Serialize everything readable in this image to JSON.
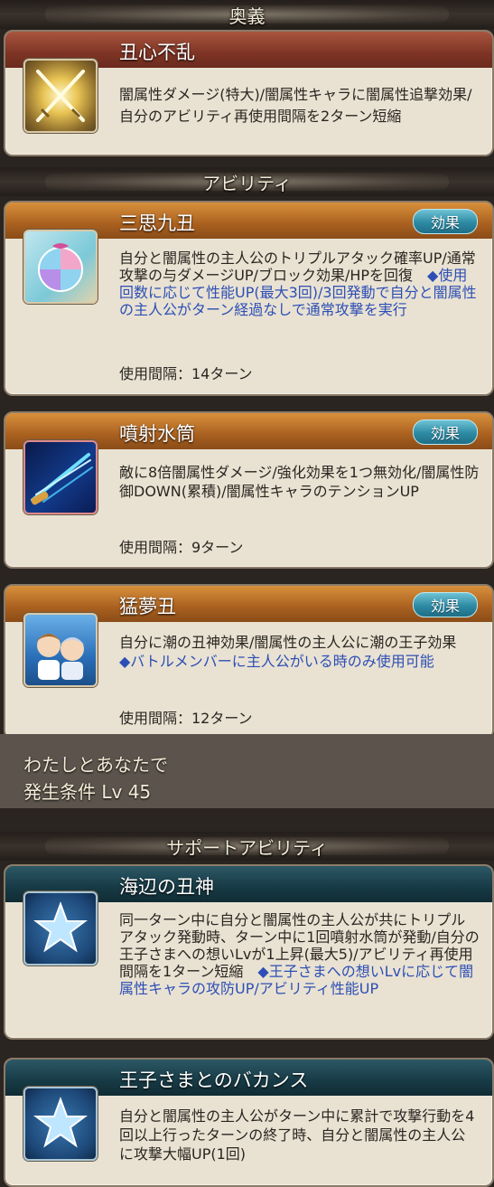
{
  "sections": {
    "ougi": "奥義",
    "ability": "アビリティ",
    "support": "サポートアビリティ"
  },
  "ougi": {
    "name": "丑心不乱",
    "desc": "闇属性ダメージ(特大)/闇属性キャラに闇属性追撃効果/自分のアビリティ再使用間隔を2ターン短縮",
    "icon": "crossed-swords-icon"
  },
  "abilities": [
    {
      "name": "三思九丑",
      "button": "効果",
      "desc": "自分と闇属性の主人公のトリプルアタック確率UP/通常攻撃の与ダメージUP/ブロック効果/HPを回復　",
      "desc_blue": "◆使用回数に応じて性能UP(最大3回)/3回発動で自分と闇属性の主人公がターン経過なしで通常攻撃を実行",
      "cooldown": "使用間隔：14ターン",
      "icon": "beach-ball-icon"
    },
    {
      "name": "噴射水筒",
      "button": "効果",
      "desc": "敵に8倍闇属性ダメージ/強化効果を1つ無効化/闇属性防御DOWN(累積)/闇属性キャラのテンションUP",
      "desc_blue": "",
      "cooldown": "使用間隔：9ターン",
      "icon": "water-jet-icon"
    },
    {
      "name": "猛夢丑",
      "button": "効果",
      "desc": "自分に潮の丑神効果/闇属性の主人公に潮の王子効果　",
      "desc_blue": "◆バトルメンバーに主人公がいる時のみ使用可能",
      "cooldown": "使用間隔：12ターン",
      "icon": "characters-portrait-icon"
    }
  ],
  "unlock": {
    "line1": "わたしとあなたで",
    "line2": "発生条件 Lv 45"
  },
  "support_abilities": [
    {
      "name": "海辺の丑神",
      "desc": "同一ターン中に自分と闇属性の主人公が共にトリプルアタック発動時、ターン中に1回噴射水筒が発動/自分の王子さまへの想いLvが1上昇(最大5)/アビリティ再使用間隔を1ターン短縮　",
      "desc_blue": "◆王子さまへの想いLvに応じて闇属性キャラの攻防UP/アビリティ性能UP",
      "icon": "star-icon"
    },
    {
      "name": "王子さまとのバカンス",
      "desc": "自分と闇属性の主人公がターン中に累計で攻撃行動を4回以上行ったターンの終了時、自分と闇属性の主人公に攻撃大幅UP(1回)",
      "desc_blue": "",
      "icon": "star-icon"
    }
  ]
}
